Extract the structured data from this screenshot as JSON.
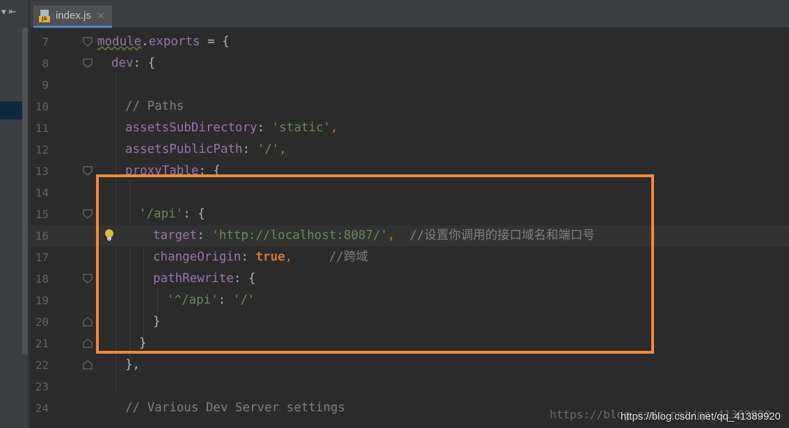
{
  "tab": {
    "label": "index.js",
    "close": "×",
    "badge": "JS"
  },
  "left_panel": {
    "controls": "▾  ⇤"
  },
  "lines": [
    {
      "num": "7"
    },
    {
      "num": "8"
    },
    {
      "num": "9"
    },
    {
      "num": "10"
    },
    {
      "num": "11"
    },
    {
      "num": "12"
    },
    {
      "num": "13"
    },
    {
      "num": "14"
    },
    {
      "num": "15"
    },
    {
      "num": "16"
    },
    {
      "num": "17"
    },
    {
      "num": "18"
    },
    {
      "num": "19"
    },
    {
      "num": "20"
    },
    {
      "num": "21"
    },
    {
      "num": "22"
    },
    {
      "num": "23"
    },
    {
      "num": "24"
    }
  ],
  "code": {
    "l7_module": "module",
    "l7_dot": ".",
    "l7_exports": "exports",
    "l7_rest": " = {",
    "l8_dev": "dev",
    "l8_rest": ": {",
    "l10_comment": "// Paths",
    "l11_key": "assetsSubDirectory",
    "l11_colon": ": ",
    "l11_val": "'static'",
    "l11_end": ",",
    "l12_key": "assetsPublicPath",
    "l12_colon": ": ",
    "l12_val": "'/'",
    "l12_end": ",",
    "l13_key": "proxyTable",
    "l13_rest": ": {",
    "l15_key": "'/api'",
    "l15_rest": ": {",
    "l16_key": "target",
    "l16_colon": ": ",
    "l16_val": "'http://localhost:8087/'",
    "l16_end": ",  ",
    "l16_comment": "//设置你调用的接口域名和端口号",
    "l17_key": "changeOrigin",
    "l17_colon": ": ",
    "l17_val": "true",
    "l17_end": ",     ",
    "l17_comment": "//跨域",
    "l18_key": "pathRewrite",
    "l18_rest": ": {",
    "l19_key": "'^/api'",
    "l19_colon": ": ",
    "l19_val": "'/'",
    "l20_brace": "}",
    "l21_brace": "}",
    "l22_brace": "},",
    "l24_comment": "// Various Dev Server settings"
  },
  "watermark": {
    "ghost": "https://blog.csdn.net/qq_41389920",
    "text": "https://blog.csdn.net/qq_41389920"
  },
  "colors": {
    "background": "#2b2b2b",
    "keyword": "#cc7832",
    "property": "#9876aa",
    "string": "#6a8759",
    "comment": "#808080",
    "highlight_box": "#f5893a"
  },
  "icons": {
    "fold": "fold-marker-icon",
    "bulb": "lightbulb-icon",
    "js": "js-file-icon"
  }
}
